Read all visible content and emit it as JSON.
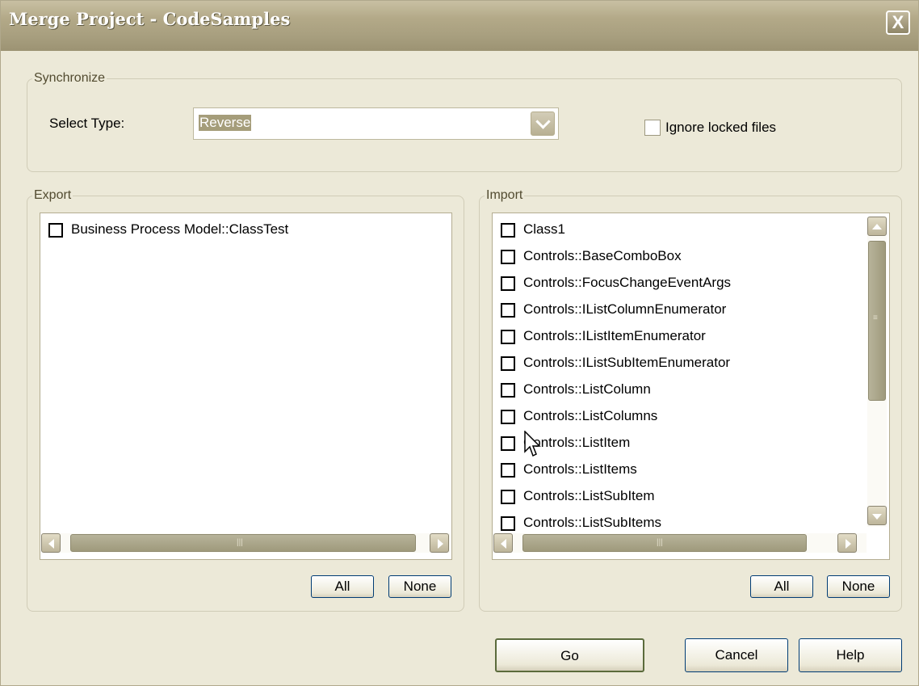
{
  "window": {
    "title": "Merge Project - CodeSamples",
    "close_label": "X"
  },
  "synchronize": {
    "legend": "Synchronize",
    "select_type_label": "Select Type:",
    "select_type_value": "Reverse",
    "ignore_locked_label": "Ignore locked files",
    "ignore_locked_checked": false
  },
  "export": {
    "legend": "Export",
    "items": [
      "Business Process Model::ClassTest"
    ],
    "all_label": "All",
    "none_label": "None"
  },
  "import": {
    "legend": "Import",
    "items": [
      "Class1",
      "Controls::BaseComboBox",
      "Controls::FocusChangeEventArgs",
      "Controls::IListColumnEnumerator",
      "Controls::IListItemEnumerator",
      "Controls::IListSubItemEnumerator",
      "Controls::ListColumn",
      "Controls::ListColumns",
      "Controls::ListItem",
      "Controls::ListItems",
      "Controls::ListSubItem",
      "Controls::ListSubItems"
    ],
    "all_label": "All",
    "none_label": "None"
  },
  "footer": {
    "go_label": "Go",
    "cancel_label": "Cancel",
    "help_label": "Help"
  },
  "colors": {
    "face": "#ece9d8",
    "title_bar": "#a89f7f",
    "selection": "#a59d7a",
    "group_text": "#524b30"
  }
}
